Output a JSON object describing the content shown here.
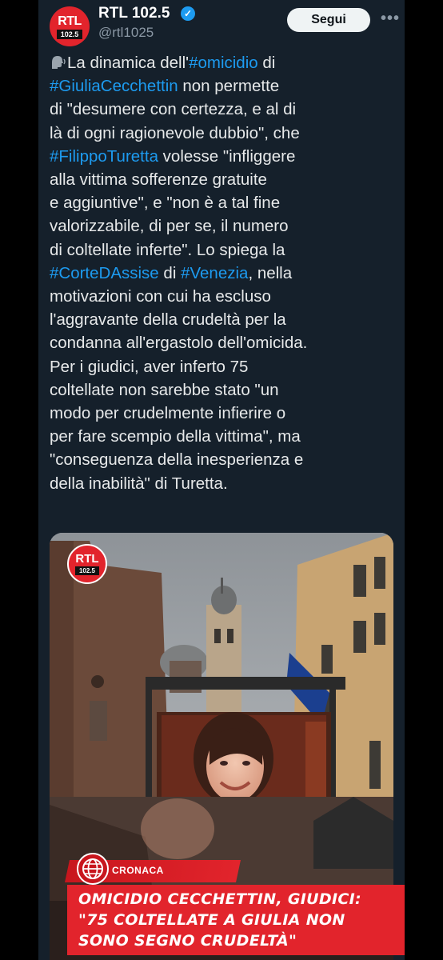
{
  "account": {
    "display_name": "RTL 102.5",
    "handle": "@rtl1025",
    "logo_top": "RTL",
    "logo_bottom": "102.5",
    "verified_icon": "verified-badge-icon"
  },
  "actions": {
    "follow_label": "Segui",
    "more_label": "•••"
  },
  "tweet": {
    "lines": [
      [
        {
          "t": "La dinamica dell'"
        },
        {
          "t": "#omicidio",
          "h": true
        },
        {
          "t": " di"
        }
      ],
      [
        {
          "t": "#GiuliaCecchettin",
          "h": true
        },
        {
          "t": " non permette"
        }
      ],
      [
        {
          "t": "di \"desumere con certezza, e al di"
        }
      ],
      [
        {
          "t": "là di ogni ragionevole dubbio\", che"
        }
      ],
      [
        {
          "t": "#FilippoTuretta",
          "h": true
        },
        {
          "t": " volesse \"infliggere"
        }
      ],
      [
        {
          "t": "alla vittima sofferenze gratuite"
        }
      ],
      [
        {
          "t": "e aggiuntive\", e \"non è a tal fine"
        }
      ],
      [
        {
          "t": "valorizzabile, di per se, il numero"
        }
      ],
      [
        {
          "t": "di coltellate inferte\". Lo spiega la"
        }
      ],
      [
        {
          "t": "#CorteDAssise",
          "h": true
        },
        {
          "t": " di "
        },
        {
          "t": "#Venezia",
          "h": true
        },
        {
          "t": ", nella"
        }
      ],
      [
        {
          "t": "motivazioni con cui ha escluso"
        }
      ],
      [
        {
          "t": "l'aggravante della crudeltà per la"
        }
      ],
      [
        {
          "t": "condanna all'ergastolo dell'omicida."
        }
      ],
      [
        {
          "t": "Per i giudici, aver inferto 75"
        }
      ],
      [
        {
          "t": "coltellate non sarebbe stato \"un"
        }
      ],
      [
        {
          "t": "modo per crudelmente infierire o"
        }
      ],
      [
        {
          "t": "per fare scempio della vittima\", ma"
        }
      ],
      [
        {
          "t": "\"conseguenza della inesperienza e"
        }
      ],
      [
        {
          "t": "della inabilità\" di Turetta."
        }
      ]
    ]
  },
  "media": {
    "logo_top": "RTL",
    "logo_bottom": "102.5",
    "category": "CRONACA",
    "headline_lines": [
      "OMICIDIO CECCHETTIN, GIUDICI:",
      "\"75 COLTELLATE A GIULIA NON",
      "SONO SEGNO CRUDELTÀ\""
    ]
  },
  "colors": {
    "background": "#15202b",
    "hashtag": "#1d9bf0",
    "brand_red": "#e2242c"
  }
}
